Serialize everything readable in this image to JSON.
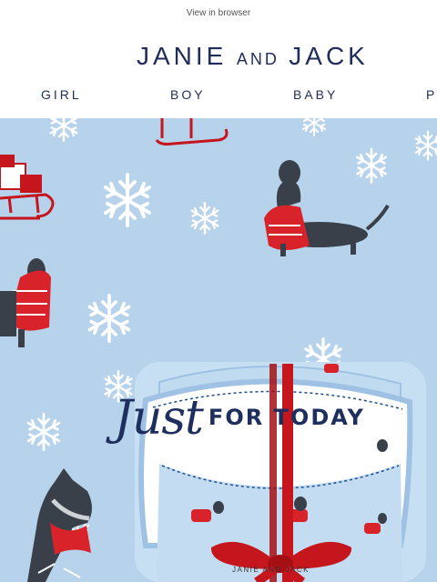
{
  "preheader": {
    "view_in_browser": "View in browser"
  },
  "brand": {
    "janie": "JANIE",
    "and": "AND",
    "jack": "JACK"
  },
  "nav": {
    "items": [
      "GIRL",
      "BOY",
      "BABY",
      "P"
    ]
  },
  "hero": {
    "headline_script": "Just",
    "headline_caps": "FOR TODAY",
    "garment_label": "JANIE AND JACK"
  },
  "colors": {
    "navy": "#1f2d5c",
    "sky": "#b7d3ec",
    "ribbon": "#c4161c"
  },
  "icons": [
    "snowflake-icon",
    "sled-icon",
    "dachshund-icon",
    "scottie-dog-icon"
  ]
}
